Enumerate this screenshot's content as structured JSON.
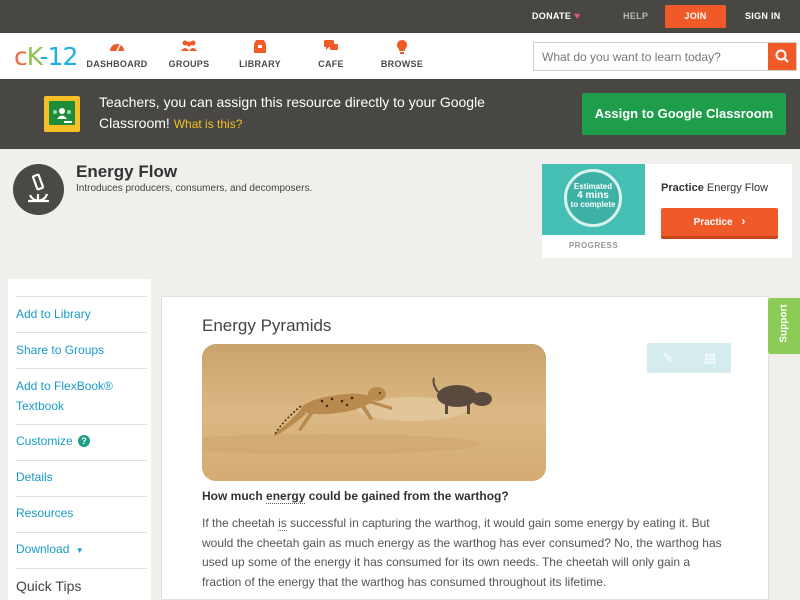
{
  "topbar": {
    "donate": "DONATE",
    "help": "HELP",
    "join": "JOIN",
    "signin": "SIGN IN"
  },
  "navbar": {
    "logo": {
      "part1": "c",
      "part2": "K",
      "part3": "-12"
    },
    "items": [
      {
        "label": "DASHBOARD",
        "icon": "dashboard-icon"
      },
      {
        "label": "GROUPS",
        "icon": "groups-icon"
      },
      {
        "label": "LIBRARY",
        "icon": "library-icon"
      },
      {
        "label": "CAFE",
        "icon": "cafe-icon"
      },
      {
        "label": "BROWSE",
        "icon": "browse-icon"
      }
    ],
    "search_placeholder": "What do you want to learn today?"
  },
  "banner": {
    "text": "Teachers, you can assign this resource directly to your Google Classroom!",
    "what_link": "What is this?",
    "assign_button": "Assign to Google Classroom"
  },
  "header": {
    "title": "Energy Flow",
    "subtitle": "Introduces producers, consumers, and decomposers."
  },
  "progress_card": {
    "estimate_line1": "Estimated",
    "estimate_line2": "4 mins",
    "estimate_line3": "to complete",
    "label": "PROGRESS",
    "title_bold": "Practice",
    "title_rest": "Energy Flow",
    "button": "Practice"
  },
  "sidebar": {
    "items": [
      {
        "label": "Add to Library"
      },
      {
        "label": "Share to Groups"
      },
      {
        "label": "Add to FlexBook® Textbook"
      },
      {
        "label": "Customize"
      },
      {
        "label": "Details"
      },
      {
        "label": "Resources"
      },
      {
        "label": "Download"
      }
    ],
    "quick_tips": "Quick Tips"
  },
  "content": {
    "section_title": "Energy Pyramids",
    "question_pre": "How much ",
    "question_term": "energy",
    "question_post": " could be gained from the warthog?",
    "paragraph_pre": "If the cheetah ",
    "paragraph_term": "is",
    "paragraph_post": " successful in capturing the warthog, it would gain some energy by eating it. But would the cheetah gain as much energy as the warthog has ever consumed? No, the warthog has used up some of the energy it has consumed for its own needs. The cheetah will only gain a fraction of the energy that the warthog has consumed throughout its lifetime."
  },
  "support_tab": "Support",
  "colors": {
    "accent_orange": "#f05a28",
    "google_green": "#1e9e4a",
    "link_blue": "#1a9bc7",
    "dark_bar": "#484744",
    "support_green": "#8ccb55"
  }
}
